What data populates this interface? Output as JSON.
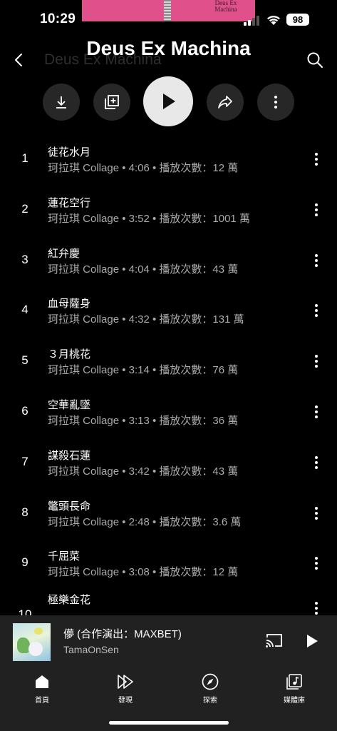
{
  "status_bar": {
    "time": "10:29",
    "battery": "98"
  },
  "album_art_top": {
    "text": "Deus Ex Machina"
  },
  "header": {
    "title": "Deus Ex Machina",
    "title_ghost": "Deus Ex Machina"
  },
  "tracks": [
    {
      "num": "1",
      "name": "徒花水月",
      "meta": "珂拉琪 Collage • 4:06 • 播放次數：12 萬"
    },
    {
      "num": "2",
      "name": "蓮花空行",
      "meta": "珂拉琪 Collage • 3:52 • 播放次數：1001 萬"
    },
    {
      "num": "3",
      "name": "紅弁慶",
      "meta": "珂拉琪 Collage • 4:04 • 播放次數：43 萬"
    },
    {
      "num": "4",
      "name": "血母薩身",
      "meta": "珂拉琪 Collage • 4:32 • 播放次數：131 萬"
    },
    {
      "num": "5",
      "name": "３月桃花",
      "meta": "珂拉琪 Collage • 3:14 • 播放次數：76 萬"
    },
    {
      "num": "6",
      "name": "空華亂墜",
      "meta": "珂拉琪 Collage • 3:13 • 播放次數：36 萬"
    },
    {
      "num": "7",
      "name": "謀殺石蓮",
      "meta": "珂拉琪 Collage • 3:42 • 播放次數：43 萬"
    },
    {
      "num": "8",
      "name": "鼈頭長命",
      "meta": "珂拉琪 Collage • 2:48 • 播放次數：3.6 萬"
    },
    {
      "num": "9",
      "name": "千屈菜",
      "meta": "珂拉琪 Collage • 3:08 • 播放次數：12 萬"
    },
    {
      "num": "10",
      "name": "極樂金花",
      "meta": ""
    }
  ],
  "mini_player": {
    "title": "儚 (合作演出：MAXBET)",
    "artist": "TamaOnSen"
  },
  "nav": [
    {
      "label": "首頁",
      "icon": "home-icon"
    },
    {
      "label": "發現",
      "icon": "explore-icon"
    },
    {
      "label": "探索",
      "icon": "compass-icon"
    },
    {
      "label": "媒體庫",
      "icon": "library-icon"
    }
  ]
}
